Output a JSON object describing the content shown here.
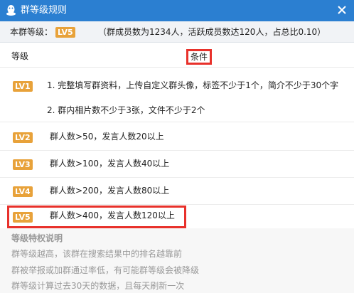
{
  "window": {
    "title": "群等级规则"
  },
  "summary": {
    "label": "本群等级：",
    "level": "LV5",
    "stats": "（群成员数为1234人，活跃成员数达120人，占总比0.10）"
  },
  "table": {
    "header_level": "等级",
    "header_condition": "条件",
    "rows": [
      {
        "level": "LV1",
        "lines": [
          "1. 完整填写群资料，上传自定义群头像，标签不少于1个，简介不少于30个字",
          "2. 群内相片数不少于3张，文件不少于2个"
        ]
      },
      {
        "level": "LV2",
        "lines": [
          "群人数>50，发言人数20以上"
        ]
      },
      {
        "level": "LV3",
        "lines": [
          "群人数>100，发言人数40以上"
        ]
      },
      {
        "level": "LV4",
        "lines": [
          "群人数>200，发言人数80以上"
        ]
      },
      {
        "level": "LV5",
        "lines": [
          "群人数>400，发言人数120以上"
        ]
      }
    ]
  },
  "privileges": {
    "title": "等级特权说明",
    "lines": [
      "群等级越高，该群在搜索结果中的排名越靠前",
      "群被举报或加群通过率低，有可能群等级会被降级",
      "群等级计算过去30天的数据，且每天刷新一次"
    ]
  },
  "colors": {
    "titlebar": "#2b7fd1",
    "badge": "#e8a23a",
    "highlight": "#e8312b"
  }
}
